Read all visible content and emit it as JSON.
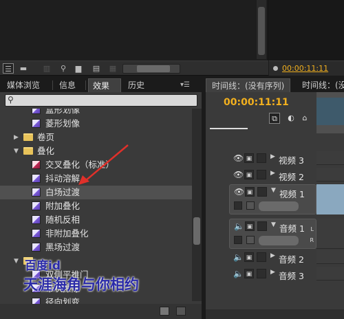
{
  "monitor": {
    "timecode": "00:00:11:11"
  },
  "left_panel": {
    "tabs": [
      {
        "label": "媒体浏览"
      },
      {
        "label": "信息"
      },
      {
        "label": "效果",
        "close": "×",
        "active": true
      },
      {
        "label": "历史"
      }
    ],
    "search_placeholder": "",
    "tree": [
      {
        "type": "effect",
        "label": "盒形划像",
        "level": 2
      },
      {
        "type": "effect",
        "label": "菱形划像",
        "level": 2
      },
      {
        "type": "folder",
        "label": "卷页",
        "expanded": false
      },
      {
        "type": "folder",
        "label": "叠化",
        "expanded": true
      },
      {
        "type": "effect",
        "label": "交叉叠化（标准）",
        "level": 2,
        "icon": "red"
      },
      {
        "type": "effect",
        "label": "抖动溶解",
        "level": 2
      },
      {
        "type": "effect",
        "label": "白场过渡",
        "level": 2,
        "selected": true
      },
      {
        "type": "effect",
        "label": "附加叠化",
        "level": 2
      },
      {
        "type": "effect",
        "label": "随机反相",
        "level": 2
      },
      {
        "type": "effect",
        "label": "非附加叠化",
        "level": 2
      },
      {
        "type": "effect",
        "label": "黑场过渡",
        "level": 2
      },
      {
        "type": "folder",
        "label": "",
        "expanded": true
      },
      {
        "type": "effect",
        "label": "双侧平推门",
        "level": 2
      },
      {
        "type": "effect",
        "label": "带状擦除",
        "level": 2
      },
      {
        "type": "effect",
        "label": "径向划变",
        "level": 2
      }
    ]
  },
  "watermark": {
    "line1": "百度id",
    "line2": "天涯海角与你相约"
  },
  "timeline": {
    "tabs": [
      {
        "label": "时间线：(没有序列)",
        "active": true
      },
      {
        "label": "时间线：(没"
      }
    ],
    "timecode": "00:00:11:11",
    "tracks": [
      {
        "kind": "video",
        "label": "视频 3"
      },
      {
        "kind": "video",
        "label": "视频 2"
      },
      {
        "kind": "video",
        "label": "视频 1",
        "expanded": true
      },
      {
        "kind": "audio",
        "label": "音频 1",
        "expanded": true
      },
      {
        "kind": "audio",
        "label": "音频 2"
      },
      {
        "kind": "audio",
        "label": "音频 3"
      }
    ],
    "track_letters": {
      "l": "L",
      "r": "R"
    }
  },
  "colors": {
    "timecode": "#f2b01e",
    "arrow": "#e0302a",
    "watermark": "#2a2aa8"
  }
}
